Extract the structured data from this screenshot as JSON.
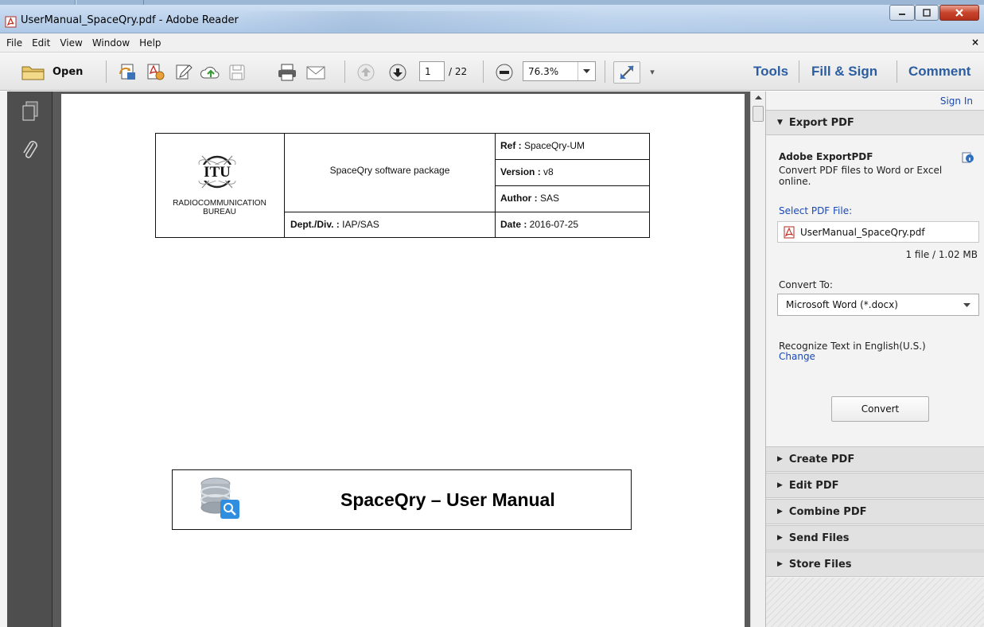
{
  "window": {
    "title": "UserManual_SpaceQry.pdf - Adobe Reader",
    "app_icon": "pdf-icon"
  },
  "menu": {
    "items": [
      "File",
      "Edit",
      "View",
      "Window",
      "Help"
    ],
    "close_glyph": "×"
  },
  "toolbar": {
    "open_label": "Open",
    "page_current": "1",
    "page_total": "/ 22",
    "zoom": "76.3%",
    "tools_label": "Tools",
    "fill_sign_label": "Fill & Sign",
    "comment_label": "Comment",
    "more_glyph": "▾"
  },
  "document": {
    "header": {
      "org_logo_text": "ITU",
      "org_name_line1": "RADIOCOMMUNICATION",
      "org_name_line2": "BUREAU",
      "package": "SpaceQry software package",
      "ref_label": "Ref :",
      "ref_value": " SpaceQry-UM",
      "version_label": "Version :",
      "version_value": " v8",
      "author_label": "Author :",
      "author_value": " SAS",
      "dept_label": "Dept./Div. :",
      "dept_value": " IAP/SAS",
      "date_label": "Date :",
      "date_value": " 2016-07-25"
    },
    "title_box": {
      "title": "SpaceQry – User Manual",
      "icon": "database-search-icon"
    }
  },
  "right_pane": {
    "sign_in": "Sign In",
    "export_pdf": {
      "header": "Export PDF",
      "service_name": "Adobe ExportPDF",
      "description": "Convert PDF files to Word or Excel online.",
      "select_label": "Select PDF File:",
      "file_name": "UserManual_SpaceQry.pdf",
      "file_info": "1 file / 1.02 MB",
      "convert_to_label": "Convert To:",
      "convert_to_value": "Microsoft Word (*.docx)",
      "recognize_text": "Recognize Text in English(U.S.)",
      "change_link": "Change",
      "convert_button": "Convert"
    },
    "sections": [
      "Create PDF",
      "Edit PDF",
      "Combine PDF",
      "Send Files",
      "Store Files"
    ]
  },
  "colors": {
    "link_blue": "#2b5ea1",
    "pane_link": "#1a49b4",
    "doc_background": "#5a5a5a",
    "nav_background": "#4e4e4e"
  }
}
